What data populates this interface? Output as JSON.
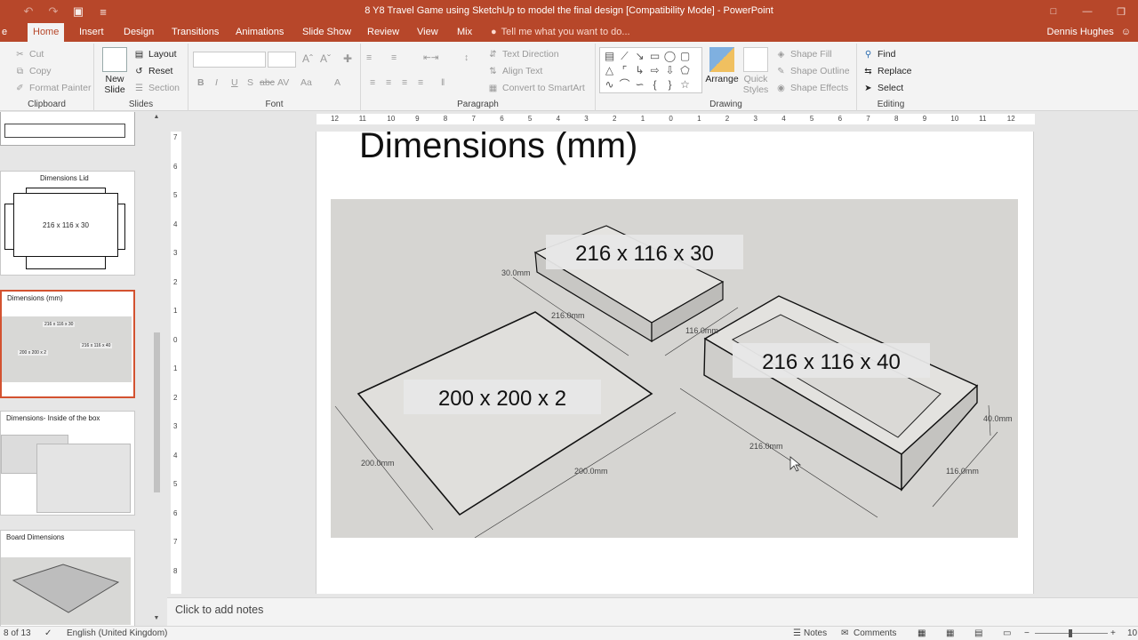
{
  "window": {
    "title": "8 Y8 Travel Game using SketchUp to model the final design [Compatibility Mode] - PowerPoint",
    "colors": {
      "accent": "#b7472a",
      "selection": "#d35230"
    }
  },
  "tabs": [
    {
      "label": "e"
    },
    {
      "label": "Home"
    },
    {
      "label": "Insert"
    },
    {
      "label": "Design"
    },
    {
      "label": "Transitions"
    },
    {
      "label": "Animations"
    },
    {
      "label": "Slide Show"
    },
    {
      "label": "Review"
    },
    {
      "label": "View"
    },
    {
      "label": "Mix"
    }
  ],
  "tell_me": "Tell me what you want to do...",
  "user": {
    "name": "Dennis Hughes"
  },
  "ribbon": {
    "clipboard": {
      "cut": "Cut",
      "copy": "Copy",
      "format_painter": "Format Painter",
      "label": "Clipboard"
    },
    "slides": {
      "new_slide": "New",
      "new_slide_2": "Slide",
      "layout": "Layout",
      "reset": "Reset",
      "section": "Section",
      "label": "Slides"
    },
    "font": {
      "label": "Font"
    },
    "paragraph": {
      "text_direction": "Text Direction",
      "align_text": "Align Text",
      "convert_smartart": "Convert to SmartArt",
      "label": "Paragraph"
    },
    "drawing": {
      "arrange": "Arrange",
      "quick_styles": "Quick",
      "quick_styles_2": "Styles",
      "shape_fill": "Shape Fill",
      "shape_outline": "Shape Outline",
      "shape_effects": "Shape Effects",
      "label": "Drawing"
    },
    "editing": {
      "find": "Find",
      "replace": "Replace",
      "select": "Select",
      "label": "Editing"
    }
  },
  "thumbnails": [
    {
      "title": ""
    },
    {
      "title": "Dimensions Lid",
      "dims": "216 x 116 x 30"
    },
    {
      "title": "Dimensions (mm)",
      "label_a": "216 x 116 x 30",
      "label_b": "216 x 116 x 40",
      "label_c": "200 x 200 x 2"
    },
    {
      "title": "Dimensions- Inside of the box"
    },
    {
      "title": "Board Dimensions"
    }
  ],
  "ruler_h": [
    "12",
    "11",
    "10",
    "9",
    "8",
    "7",
    "6",
    "5",
    "4",
    "3",
    "2",
    "1",
    "0",
    "1",
    "2",
    "3",
    "4",
    "5",
    "6",
    "7",
    "8",
    "9",
    "10",
    "11",
    "12"
  ],
  "ruler_v": [
    "7",
    "6",
    "5",
    "4",
    "3",
    "2",
    "1",
    "0",
    "1",
    "2",
    "3",
    "4",
    "5",
    "6",
    "7",
    "8"
  ],
  "slide": {
    "title": "Dimensions (mm)",
    "labels": {
      "lid": "216 x 116 x 30",
      "box": "216 x 116 x 40",
      "board": "200 x 200 x 2"
    },
    "measures": {
      "lid_h": "30.0mm",
      "lid_len": "216.0mm",
      "lid_w": "116.0mm",
      "board_left": "200.0mm",
      "board_right": "200.0mm",
      "box_len": "216.0mm",
      "box_w": "116.0mm",
      "box_h": "40.0mm"
    }
  },
  "notes": "Click to add notes",
  "status": {
    "slide": "8 of 13",
    "language": "English (United Kingdom)",
    "notes": "Notes",
    "comments": "Comments",
    "zoom": "10"
  }
}
